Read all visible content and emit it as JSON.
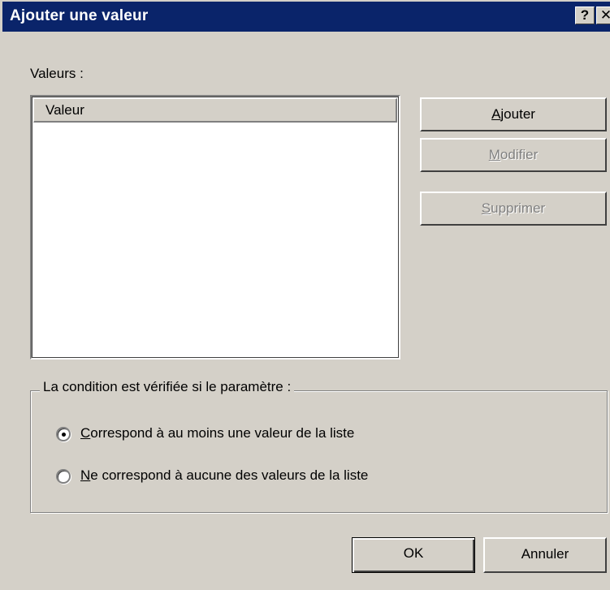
{
  "window": {
    "title": "Ajouter une valeur",
    "help_glyph": "?",
    "close_glyph": "✕"
  },
  "values_label": "Valeurs :",
  "list": {
    "column_header": "Valeur",
    "rows": []
  },
  "buttons": {
    "add": {
      "mnemonic": "A",
      "rest": "jouter",
      "enabled": true
    },
    "modify": {
      "mnemonic": "M",
      "rest": "odifier",
      "enabled": false
    },
    "delete": {
      "mnemonic": "S",
      "rest": "upprimer",
      "enabled": false
    },
    "ok": "OK",
    "cancel": "Annuler"
  },
  "condition": {
    "legend": "La condition est vérifiée si le paramètre :",
    "options": [
      {
        "mnemonic": "C",
        "rest": "orrespond à au moins une valeur de la liste",
        "selected": true
      },
      {
        "mnemonic": "N",
        "rest": "e correspond à aucune des valeurs de la liste",
        "selected": false
      }
    ]
  }
}
